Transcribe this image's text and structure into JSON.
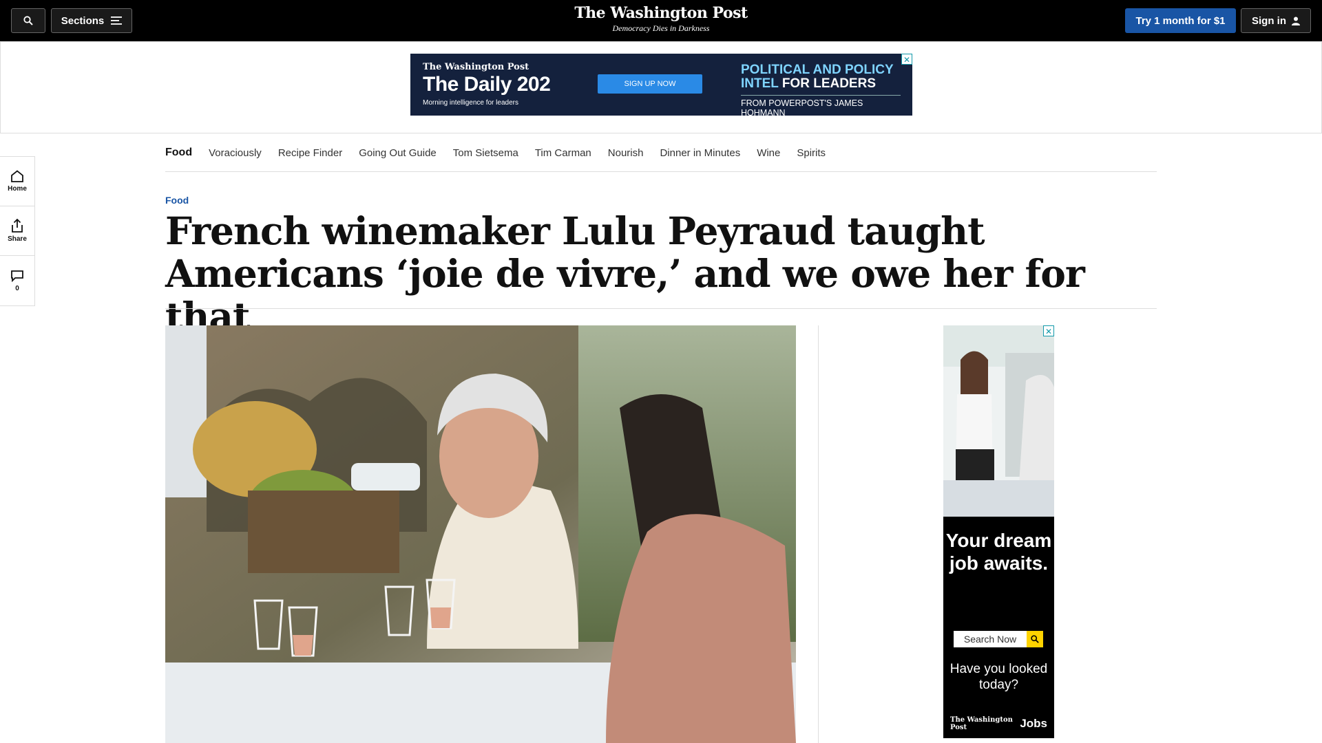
{
  "header": {
    "sections_label": "Sections",
    "logo_text": "The Washington Post",
    "tagline": "Democracy Dies in Darkness",
    "subscribe_label": "Try 1 month for $1",
    "signin_label": "Sign in"
  },
  "top_ad": {
    "logo_text": "The Washington Post",
    "title": "The Daily 202",
    "subtitle": "Morning intelligence for leaders",
    "cta": "SIGN UP NOW",
    "right_line1": "POLITICAL AND POLICY",
    "right_line2_a": "INTEL ",
    "right_line2_b": "FOR LEADERS",
    "right_foot": "FROM POWERPOST'S JAMES HOHMANN",
    "close": "✕"
  },
  "rail": {
    "home_label": "Home",
    "share_label": "Share",
    "comments_count": "0"
  },
  "subnav": {
    "items": [
      "Food",
      "Voraciously",
      "Recipe Finder",
      "Going Out Guide",
      "Tom Sietsema",
      "Tim Carman",
      "Nourish",
      "Dinner in Minutes",
      "Wine",
      "Spirits"
    ]
  },
  "article": {
    "kicker": "Food",
    "headline": "French winemaker Lulu Peyraud taught Americans ‘joie de vivre,’ and we owe her for that"
  },
  "side_ad": {
    "headline": "Your dream job awaits.",
    "search_placeholder": "Search Now",
    "sub": "Have you looked today?",
    "logo_text": "The Washington Post",
    "jobs_label": "Jobs",
    "close": "✕"
  }
}
